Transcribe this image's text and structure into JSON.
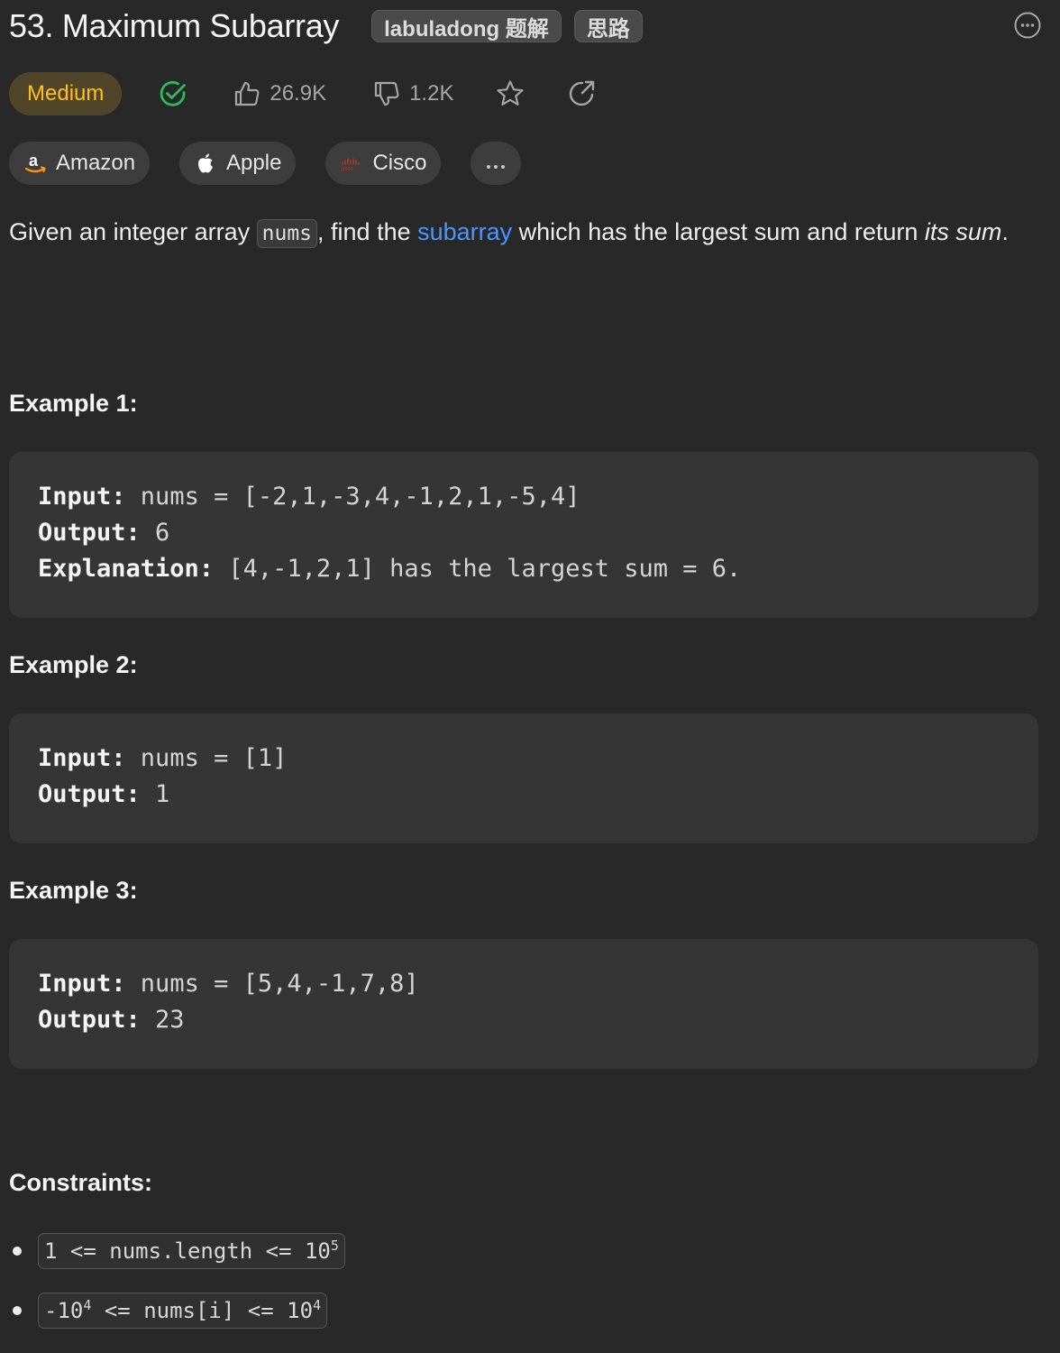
{
  "problem": {
    "title": "53. Maximum Subarray",
    "tag_buttons": [
      "labuladong 题解",
      "思路"
    ],
    "difficulty": "Medium",
    "likes": "26.9K",
    "dislikes": "1.2K"
  },
  "companies": [
    "Amazon",
    "Apple",
    "Cisco"
  ],
  "description": {
    "p1": "Given an integer array ",
    "code": "nums",
    "p2": ", find the ",
    "link": "subarray",
    "p3": " which has the largest sum and return ",
    "em": "its sum",
    "p4": "."
  },
  "examples": [
    {
      "heading": "Example 1:",
      "input_label": "Input:",
      "input": " nums = [-2,1,-3,4,-1,2,1,-5,4]",
      "output_label": "Output:",
      "output": " 6",
      "explanation_label": "Explanation:",
      "explanation": " [4,-1,2,1] has the largest sum = 6."
    },
    {
      "heading": "Example 2:",
      "input_label": "Input:",
      "input": " nums = [1]",
      "output_label": "Output:",
      "output": " 1"
    },
    {
      "heading": "Example 3:",
      "input_label": "Input:",
      "input": " nums = [5,4,-1,7,8]",
      "output_label": "Output:",
      "output": " 23"
    }
  ],
  "constraints": {
    "heading": "Constraints:",
    "c1": {
      "pre": "1 <= nums.length <= 10",
      "exp": "5"
    },
    "c2": {
      "pre1": "-10",
      "exp1": "4",
      "mid": " <= nums[i] <= 10",
      "exp2": "4"
    }
  },
  "icons": {
    "more": "more-horizontal-circle-icon",
    "solved": "check-circle-icon",
    "like": "thumbs-up-icon",
    "dislike": "thumbs-down-icon",
    "star": "star-icon",
    "share": "share-icon"
  },
  "colors": {
    "background": "#282828",
    "difficulty_bg": "#514529",
    "difficulty_text": "#ffc01e",
    "solved": "#2cbb5d",
    "link": "#4a96ff"
  }
}
